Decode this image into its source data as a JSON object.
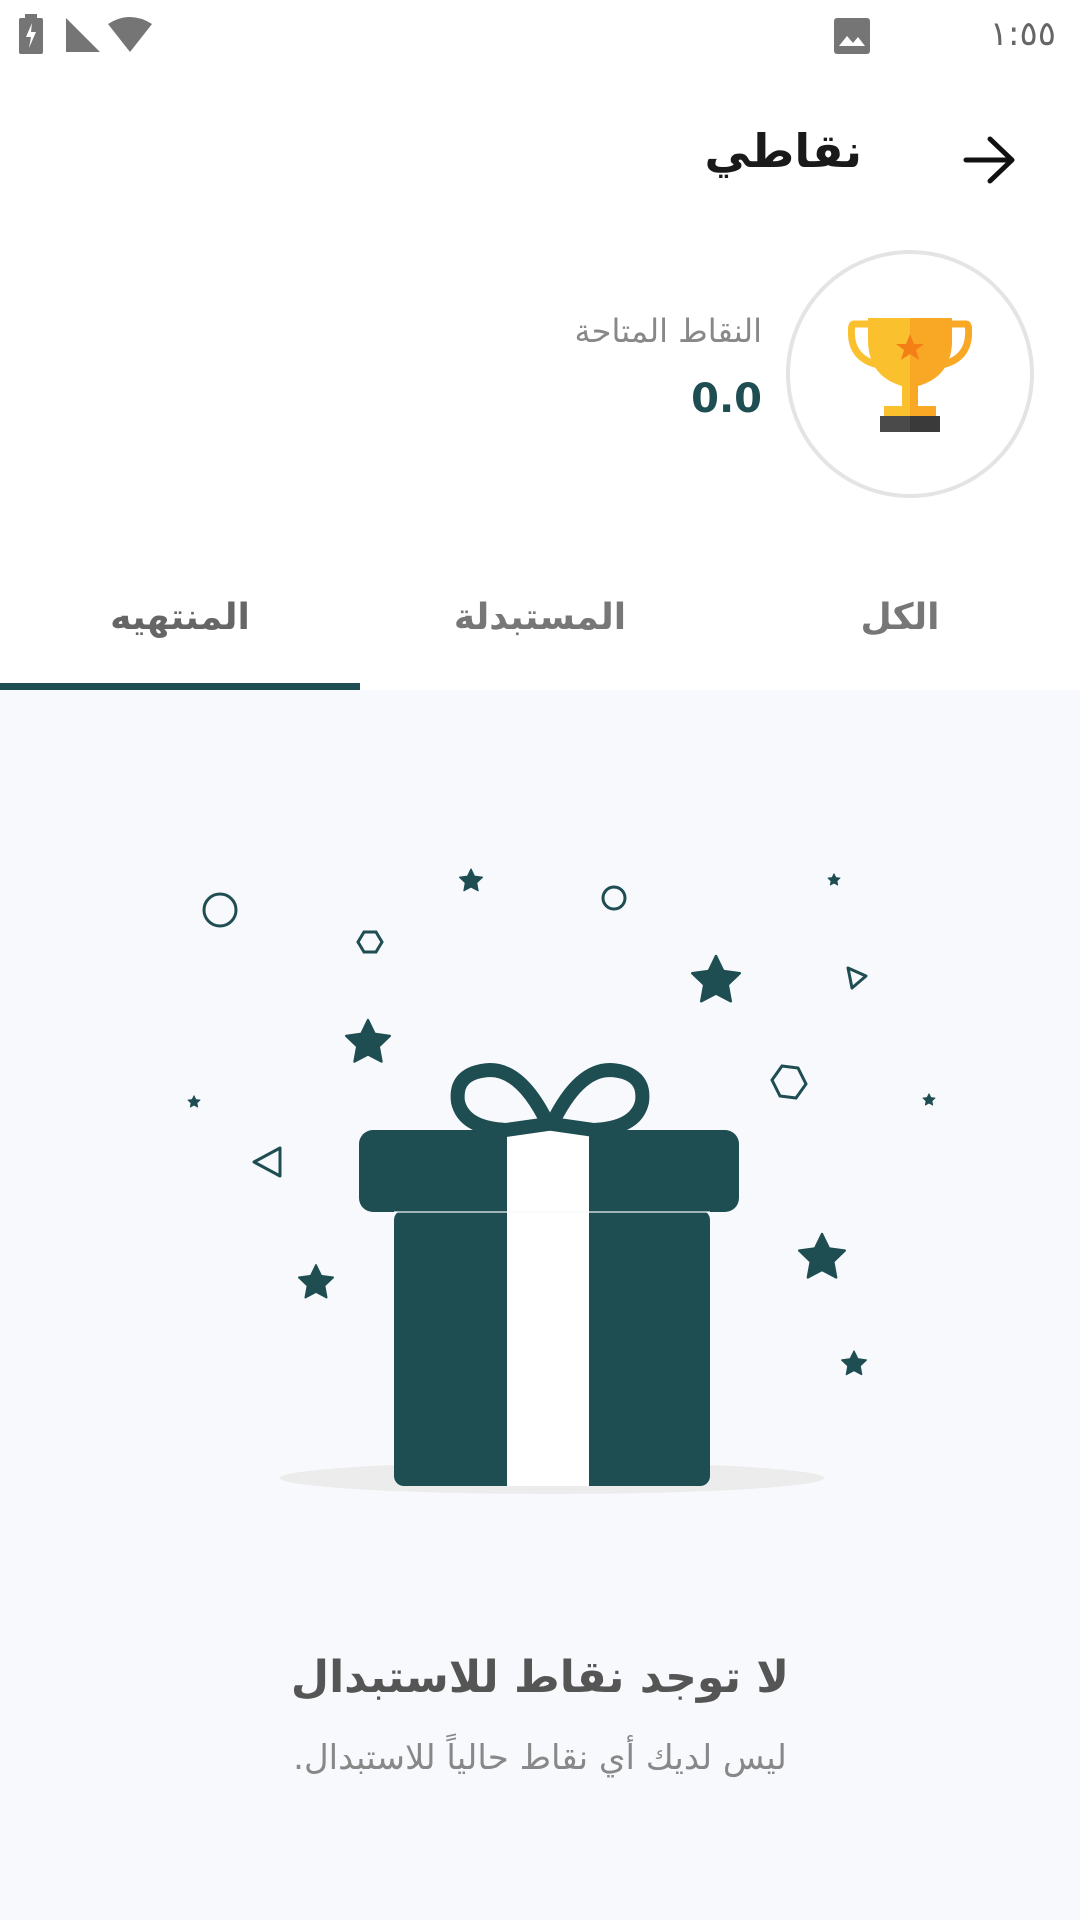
{
  "status_bar": {
    "time": "١:٥٥",
    "icons": [
      "battery-charging-icon",
      "signal-icon",
      "wifi-icon",
      "image-notification-icon"
    ]
  },
  "app_bar": {
    "title": "نقاطي",
    "back_icon": "arrow-right-icon"
  },
  "points": {
    "label": "النقاط المتاحة",
    "value": "0.0",
    "icon": "trophy-icon"
  },
  "tabs": [
    {
      "label": "الكل",
      "active": false
    },
    {
      "label": "المستبدلة",
      "active": false
    },
    {
      "label": "المنتهيه",
      "active": true
    }
  ],
  "empty_state": {
    "title": "لا توجد نقاط للاستبدال",
    "subtitle": "ليس لديك أي نقاط حالياً للاستبدال.",
    "icon": "gift-icon"
  },
  "colors": {
    "accent": "#1e4d52",
    "trophy_gold": "#fbc02d",
    "background": "#f8f9fc"
  }
}
